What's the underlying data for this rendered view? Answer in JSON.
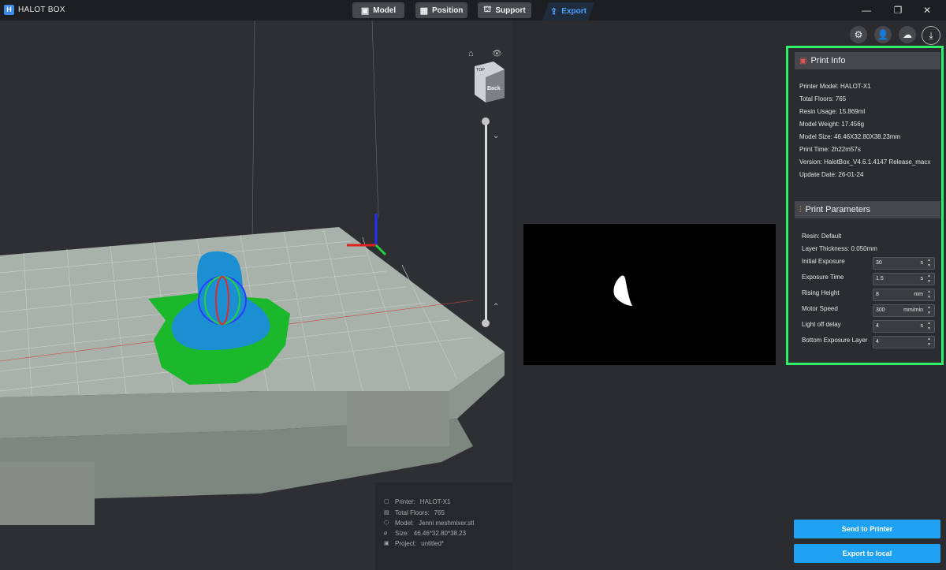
{
  "app": {
    "logo_letter": "H",
    "title": "HALOT BOX"
  },
  "tabs": [
    {
      "icon": "cube-icon",
      "glyph": "▣",
      "label": "Model"
    },
    {
      "icon": "position-icon",
      "glyph": "▦",
      "label": "Position"
    },
    {
      "icon": "support-icon",
      "glyph": "⛫",
      "label": "Support"
    },
    {
      "icon": "export-icon",
      "glyph": "⇪",
      "label": "Export"
    }
  ],
  "window_controls": {
    "minimize": "—",
    "restore": "❐",
    "close": "✕"
  },
  "viewport": {
    "view_cube_face": "Back",
    "view_cube_top": "ᴛoᴘ",
    "home_glyph": "⌂",
    "eye_glyph": "👁",
    "slider_up": "⌃",
    "slider_down": "⌄",
    "layer_slider": {
      "top_fraction": 0.0,
      "bottom_fraction": 1.0
    }
  },
  "status": {
    "printer_label": "Printer:",
    "printer_value": "HALOT-X1",
    "floors_label": "Total Floors:",
    "floors_value": "765",
    "model_label": "Model:",
    "model_value": "Jenni meshmixer.stl",
    "size_label": "Size:",
    "size_value": "46.46*32.80*38.23",
    "project_label": "Project:",
    "project_value": "untitled*"
  },
  "toolbar_icons": [
    {
      "name": "settings-icon",
      "glyph": "⚙"
    },
    {
      "name": "user-icon",
      "glyph": "👤"
    },
    {
      "name": "cloud-printer-icon",
      "glyph": "☁"
    },
    {
      "name": "download-icon",
      "glyph": "⤓"
    }
  ],
  "print_info": {
    "title": "Print Info",
    "lines": [
      "Printer Model: HALOT-X1",
      "Total Floors: 765",
      "Resin Usage: 15.869ml",
      "Model Weight: 17.456g",
      "Model Size: 46.46X32.80X38.23mm",
      "Print Time: 2h22m57s",
      "Version: HalotBox_V4.6.1.4147 Release_macx",
      "Update Date: 26-01-24"
    ]
  },
  "print_parameters": {
    "title": "Print Parameters",
    "resin": "Resin: Default",
    "layer_thickness": "Layer Thickness: 0.050mm",
    "params": [
      {
        "label": "Initial Exposure",
        "value": "30",
        "unit": "s"
      },
      {
        "label": "Exposure Time",
        "value": "1.5",
        "unit": "s"
      },
      {
        "label": "Rising Height",
        "value": "8",
        "unit": "mm"
      },
      {
        "label": "Motor Speed",
        "value": "300",
        "unit": "mm/min"
      },
      {
        "label": "Light off delay",
        "value": "4",
        "unit": "s"
      },
      {
        "label": "Bottom Exposure Layer",
        "value": "4",
        "unit": ""
      }
    ]
  },
  "actions": {
    "send": "Send to Printer",
    "export": "Export to local"
  },
  "colors": {
    "accent": "#1ea1f2",
    "highlight_border": "#2ef06a",
    "model": "#1b8fd1",
    "support_base": "#17c22a"
  }
}
